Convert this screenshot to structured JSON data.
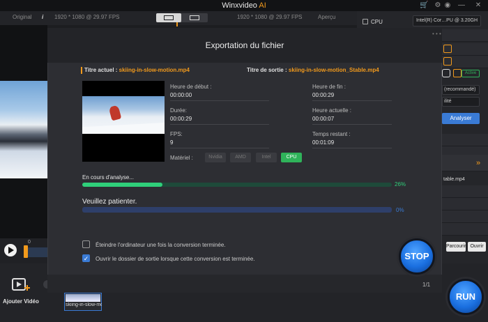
{
  "app": {
    "title_main": "Winxvideo",
    "title_ai": "AI"
  },
  "preview_header": {
    "original_label": "Original",
    "info_icon": "i",
    "resolution": "1920 * 1080 @ 29.97 FPS",
    "resolution_right": "1920 * 1080 @ 29.97 FPS",
    "apercu_label": "Aperçu"
  },
  "player": {
    "scrub_value": "0"
  },
  "bottom": {
    "add_video_label": "Ajouter Vidéo",
    "thumb_caption": "skiing-in-slow-mo"
  },
  "right_panel": {
    "cpu_label": "CPU",
    "cpu_select": "Intel(R) Cor…PU @ 3.20GH",
    "active_badge": "Active",
    "select1": "(recommandé)",
    "select2": "ilité",
    "analyser_button": "Analyser",
    "stable_filename": "table.mp4",
    "parcourir_button": "Parcourir",
    "ouvrir_button": "Ouvrir"
  },
  "modal": {
    "title": "Exportation du fichier",
    "current_title_label": "Titre actuel :",
    "current_title_value": "skiing-in-slow-motion.mp4",
    "output_title_label": "Titre de sortie :",
    "output_title_value": "skiing-in-slow-motion_Stable.mp4",
    "start_label": "Heure de début :",
    "start_value": "00:00:00",
    "end_label": "Heure de fin :",
    "end_value": "00:00:29",
    "duration_label": "Durée:",
    "duration_value": "00:00:29",
    "current_time_label": "Heure actuelle :",
    "current_time_value": "00:00:07",
    "fps_label": "FPS:",
    "fps_value": "9",
    "remaining_label": "Temps restant :",
    "remaining_value": "00:01:09",
    "hardware_label": "Matériel :",
    "hardware_options": [
      "Nvidia",
      "AMD",
      "Intel",
      "CPU"
    ],
    "hardware_selected": "CPU",
    "analysis_label": "En cours d'analyse...",
    "analysis_progress": 26,
    "analysis_percent": "26%",
    "wait_label": "Veuillez patienter.",
    "wait_progress": 0,
    "wait_percent": "0%",
    "shutdown_label": "Éteindre l'ordinateur une fois la conversion terminée.",
    "shutdown_checked": false,
    "open_folder_label": "Ouvrir le dossier de sortie lorsque cette conversion est terminée.",
    "open_folder_checked": true,
    "pager": "1/1",
    "stop_button": "STOP"
  },
  "run_button": "RUN",
  "colors": {
    "accent": "#f29a1c",
    "progress": "#2fcf7a",
    "blue": "#3a7bd5"
  }
}
